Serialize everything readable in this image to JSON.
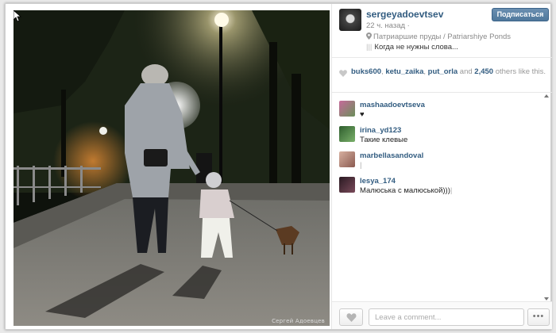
{
  "photo": {
    "watermark": "Сергей Адоевцев"
  },
  "post": {
    "username": "sergeyadoevtsev",
    "follow_label": "Подписаться",
    "time_ago": "22 ч. назад ·",
    "location": "Патриаршие пруды / Patriarshiye Ponds",
    "caption": "Когда не нужны слова..."
  },
  "likes": {
    "users": [
      "buks600",
      "ketu_zaika",
      "put_orla"
    ],
    "separator": ", ",
    "and_text": " and ",
    "count": "2,450",
    "suffix": " others like this."
  },
  "comments": [
    {
      "user": "mashaadoevtseva",
      "text": "♥",
      "avatar_color": "#6a8f5a"
    },
    {
      "user": "irina_yd123",
      "text": "Такие клевые",
      "avatar_color": "#3d7a3a"
    },
    {
      "user": "marbellasandoval",
      "text": "",
      "avatar_color": "#a07a6a"
    },
    {
      "user": "lesya_174",
      "text": "Малюська с малюськой)))",
      "avatar_color": "#4a2c3a"
    }
  ],
  "footer": {
    "comment_placeholder": "Leave a comment...",
    "more_label": "•••"
  },
  "colors": {
    "link": "#325c80",
    "follow_button": "#5a82a6"
  }
}
